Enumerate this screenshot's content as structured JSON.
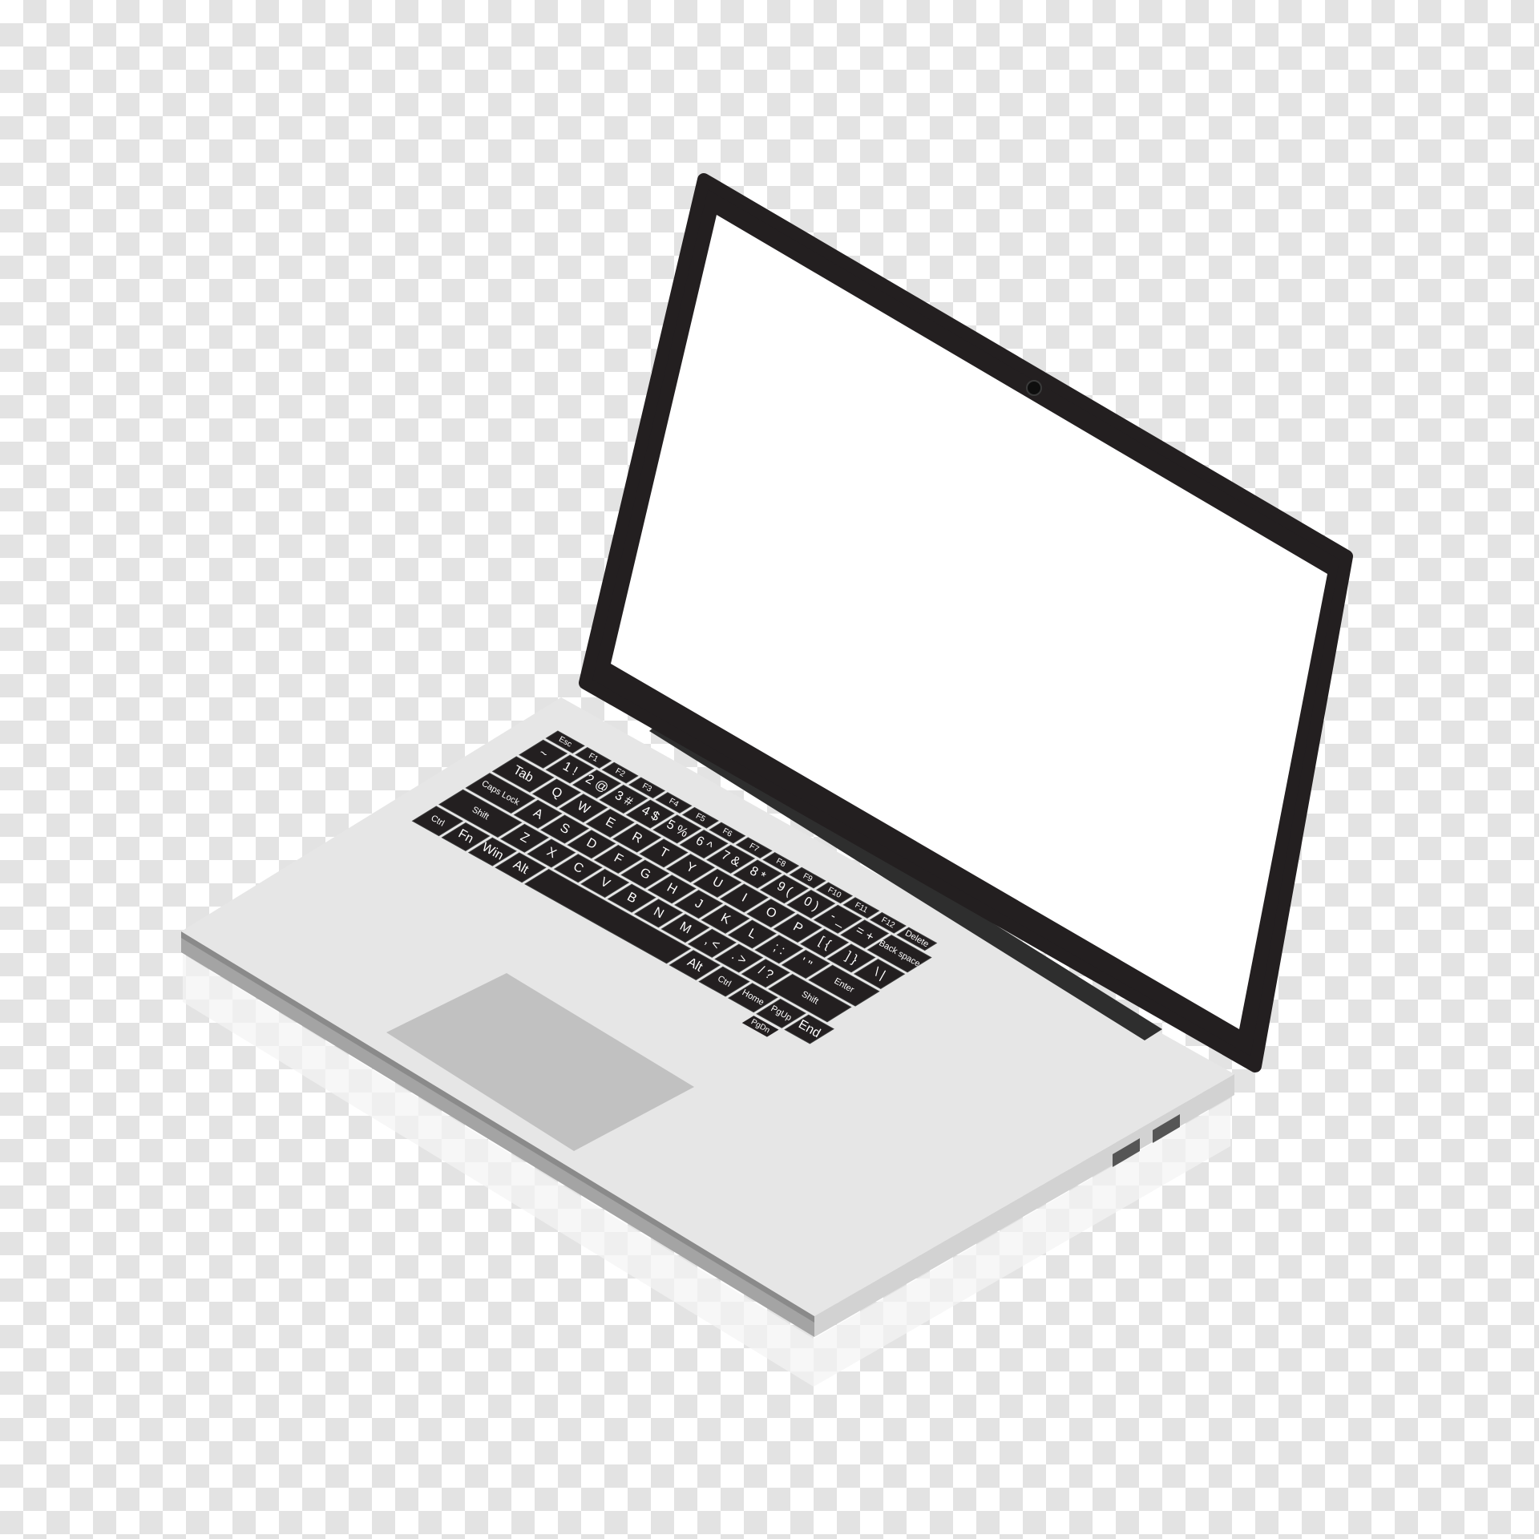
{
  "colors": {
    "checker_light": "#ffffff",
    "checker_dark": "#e3e3e3",
    "bezel": "#231f20",
    "screen": "#ffffff",
    "deck": "#e6e6e6",
    "deck_edge": "#8c8c8c",
    "touchpad": "#c1c1c1",
    "key": "#231f20",
    "key_label": "#ffffff"
  },
  "keyboard": {
    "rows": [
      [
        "Esc",
        "F1",
        "F2",
        "F3",
        "F4",
        "F5",
        "F6",
        "F7",
        "F8",
        "F9",
        "F10",
        "F11",
        "F12",
        "Delete"
      ],
      [
        "~",
        "1 !",
        "2 @",
        "3 #",
        "4 $",
        "5 %",
        "6 ^",
        "7 &",
        "8 *",
        "9 (",
        "0 )",
        "- _",
        "= +",
        "Back space"
      ],
      [
        "Tab",
        "Q",
        "W",
        "E",
        "R",
        "T",
        "Y",
        "U",
        "I",
        "O",
        "P",
        "[ {",
        "] }",
        "\\ |"
      ],
      [
        "Caps Lock",
        "A",
        "S",
        "D",
        "F",
        "G",
        "H",
        "J",
        "K",
        "L",
        "; :",
        "' \"",
        "Enter"
      ],
      [
        "Shift",
        "Z",
        "X",
        "C",
        "V",
        "B",
        "N",
        "M",
        ", <",
        ". >",
        "/ ?",
        "Shift"
      ],
      [
        "Ctrl",
        "Fn",
        "Win",
        "Alt",
        "",
        "Alt",
        "Ctrl",
        "Home",
        "PgUp",
        "End"
      ]
    ],
    "aux_keys": [
      "PgDn"
    ]
  },
  "ports": [
    "usb-port",
    "usb-port"
  ],
  "icons": [
    "webcam-icon",
    "shift-arrow-icon",
    "enter-arrow-icon",
    "window-icon"
  ]
}
